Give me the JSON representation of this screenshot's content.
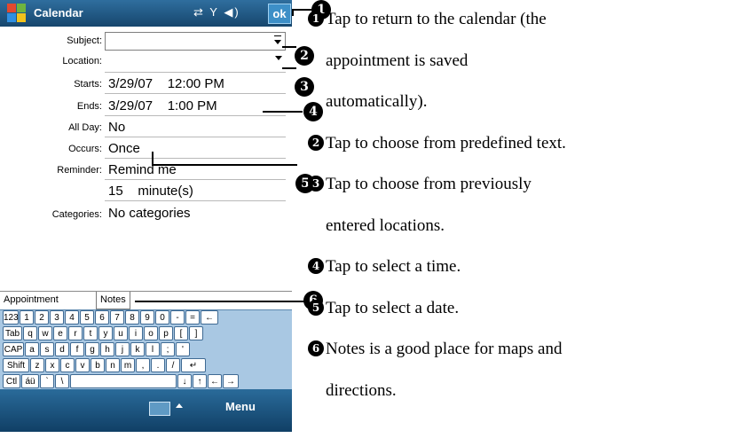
{
  "device": {
    "app_title": "Calendar",
    "tray_icons": [
      "connectivity-icon",
      "signal-icon",
      "volume-icon"
    ],
    "ok_label": "ok",
    "fields": [
      {
        "label": "Subject:",
        "value": "",
        "has_dropdown": true
      },
      {
        "label": "Location:",
        "value": "",
        "has_dropdown": true
      },
      {
        "label": "Starts:",
        "value": "3/29/07    12:00 PM"
      },
      {
        "label": "Ends:",
        "value": "3/29/07    1:00 PM"
      },
      {
        "label": "All Day:",
        "value": "No"
      },
      {
        "label": "Occurs:",
        "value": "Once"
      },
      {
        "label": "Reminder:",
        "value": "Remind me"
      },
      {
        "label": "",
        "value": "15    minute(s)"
      },
      {
        "label": "Categories:",
        "value": "No categories"
      }
    ],
    "tabs": [
      "Appointment",
      "Notes"
    ],
    "keyboard_rows": [
      [
        "123",
        "1",
        "2",
        "3",
        "4",
        "5",
        "6",
        "7",
        "8",
        "9",
        "0",
        "-",
        "=",
        "←"
      ],
      [
        "Tab",
        "q",
        "w",
        "e",
        "r",
        "t",
        "y",
        "u",
        "i",
        "o",
        "p",
        "[",
        "]"
      ],
      [
        "CAP",
        "a",
        "s",
        "d",
        "f",
        "g",
        "h",
        "j",
        "k",
        "l",
        ";",
        "'"
      ],
      [
        "Shift",
        "z",
        "x",
        "c",
        "v",
        "b",
        "n",
        "m",
        ",",
        ".",
        "/",
        "↵"
      ],
      [
        "Ctl",
        "áü",
        "`",
        "\\",
        "",
        "↓",
        "↑",
        "←",
        "→"
      ]
    ],
    "menu_label": "Menu"
  },
  "callouts": [
    "1",
    "2",
    "3",
    "4",
    "5",
    "6"
  ],
  "notes": [
    {
      "num": "1",
      "text": "Tap to return to the calendar (the"
    },
    {
      "num": "",
      "text": "appointment is saved"
    },
    {
      "num": "",
      "text": "automatically)."
    },
    {
      "num": "2",
      "text": "Tap to choose from predefined text."
    },
    {
      "num": "3",
      "text": "Tap to choose from previously"
    },
    {
      "num": "",
      "text": "entered locations."
    },
    {
      "num": "4",
      "text": "Tap to select a time."
    },
    {
      "num": "5",
      "text": "Tap to select a date."
    },
    {
      "num": "6",
      "text": "Notes is a good place for maps and"
    },
    {
      "num": "",
      "text": "directions."
    }
  ],
  "colors": {
    "titlebar": "#16466d",
    "keyboard": "#a9c8e3",
    "accent": "#3d8fc7"
  }
}
